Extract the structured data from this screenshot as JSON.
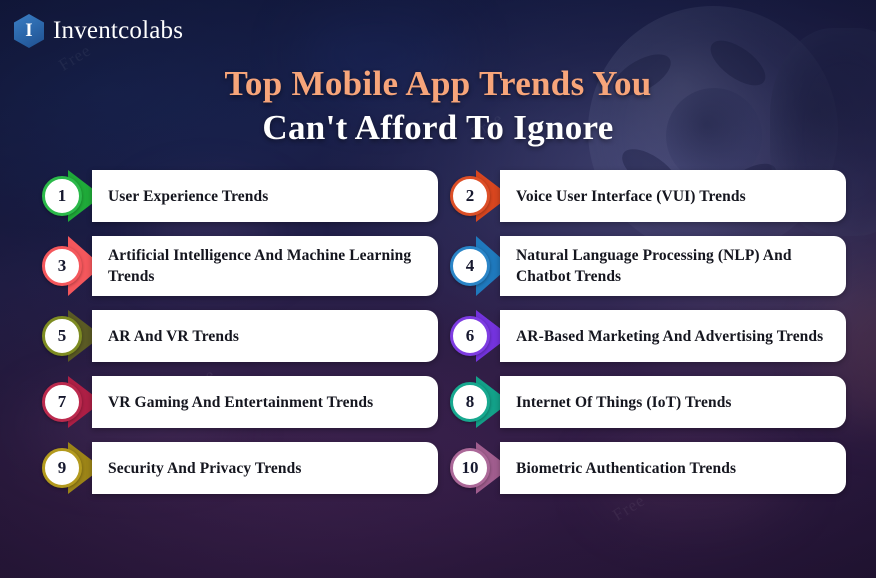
{
  "brand": {
    "name": "Inventcolabs",
    "mark_letter": "I",
    "mark_color": "#2d6aae"
  },
  "title": {
    "line1": "Top Mobile App Trends You",
    "line2": "Can't Afford To Ignore",
    "line1_color": "#f7a57a",
    "line2_color": "#ffffff"
  },
  "watermarks": [
    "Free",
    "Free",
    "Free",
    "Free"
  ],
  "items": [
    {
      "number": "1",
      "label": "User Experience Trends",
      "accent": "#1faa39",
      "ring": "#2bb94a"
    },
    {
      "number": "2",
      "label": "Voice User Interface (VUI) Trends",
      "accent": "#d8461f",
      "ring": "#dd4f27"
    },
    {
      "number": "3",
      "label": "Artificial Intelligence And Machine Learning Trends",
      "accent": "#f4575c",
      "ring": "#f4575c"
    },
    {
      "number": "4",
      "label": "Natural Language Processing (NLP) And Chatbot Trends",
      "accent": "#1f79bd",
      "ring": "#2a85c8"
    },
    {
      "number": "5",
      "label": "AR And VR Trends",
      "accent": "#5a5a24",
      "ring": "#7e8c22"
    },
    {
      "number": "6",
      "label": "AR-Based Marketing And Advertising Trends",
      "accent": "#7433de",
      "ring": "#7e3ce2"
    },
    {
      "number": "7",
      "label": "VR Gaming And Entertainment Trends",
      "accent": "#ad1f45",
      "ring": "#bc2a4e"
    },
    {
      "number": "8",
      "label": "Internet Of Things (IoT) Trends",
      "accent": "#13a189",
      "ring": "#17a88f"
    },
    {
      "number": "9",
      "label": "Security And Privacy Trends",
      "accent": "#9c8417",
      "ring": "#b39a1e"
    },
    {
      "number": "10",
      "label": "Biometric Authentication Trends",
      "accent": "#a05d8e",
      "ring": "#ab6898"
    }
  ]
}
